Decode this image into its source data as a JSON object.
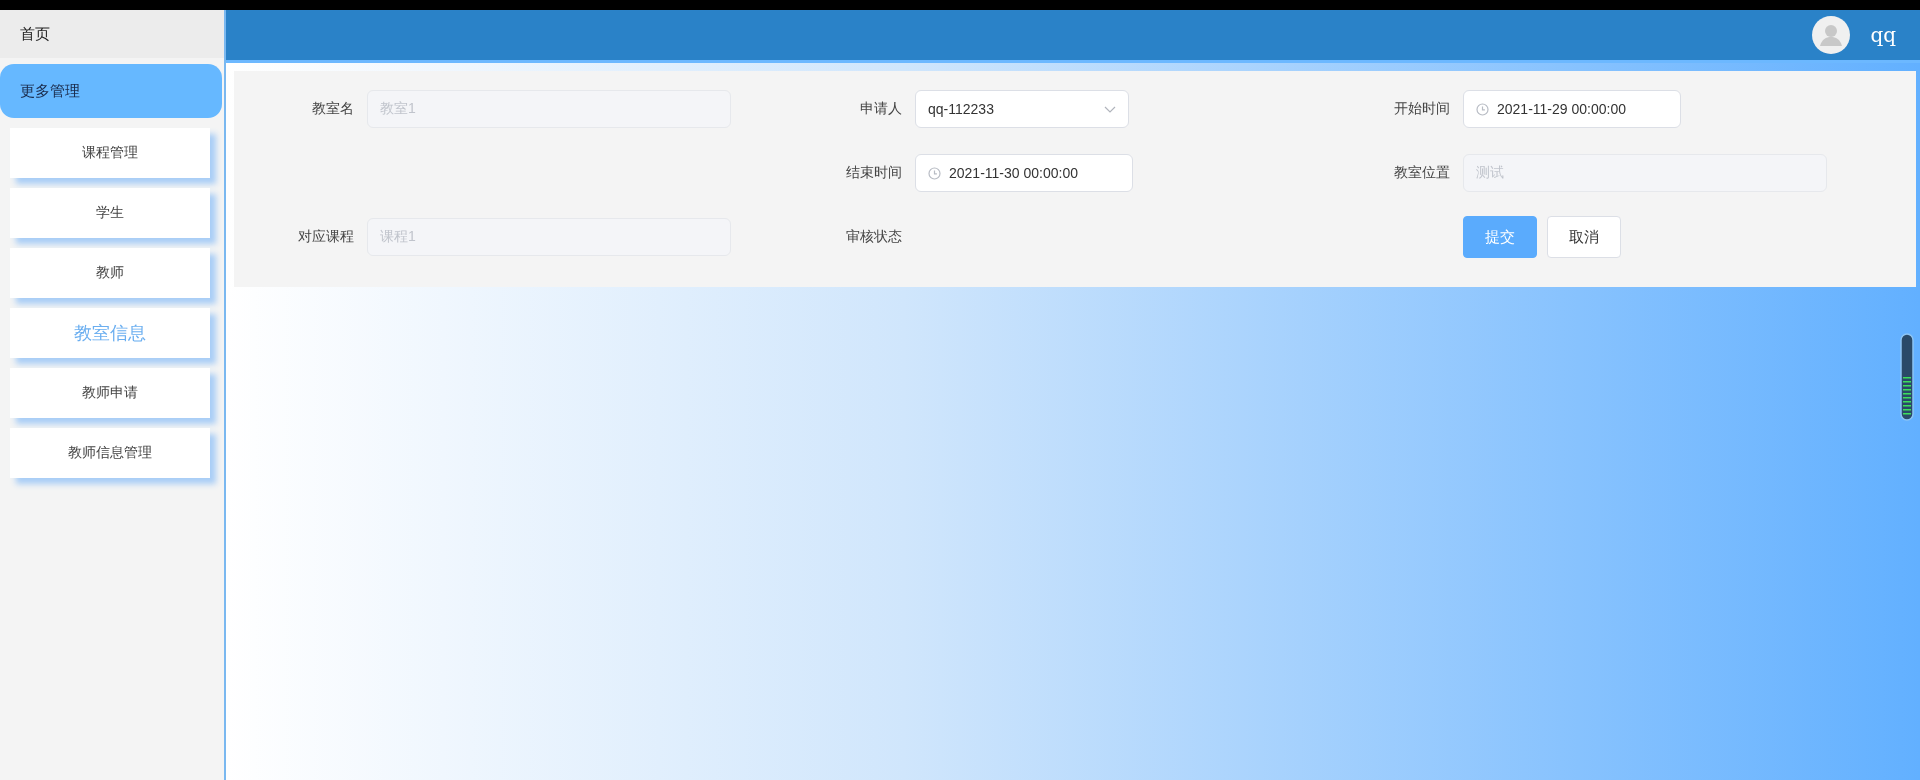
{
  "sidebar": {
    "home": "首页",
    "group": {
      "label": "更多管理"
    },
    "items": [
      {
        "label": "课程管理",
        "selected": false
      },
      {
        "label": "学生",
        "selected": false
      },
      {
        "label": "教师",
        "selected": false
      },
      {
        "label": "教室信息",
        "selected": true
      },
      {
        "label": "教师申请",
        "selected": false
      },
      {
        "label": "教师信息管理",
        "selected": false
      }
    ]
  },
  "header": {
    "user": "qq"
  },
  "form": {
    "rows": [
      [
        {
          "kind": "text",
          "label": "教室名",
          "value": "教室1",
          "disabled": true
        },
        {
          "kind": "select",
          "label": "申请人",
          "value": "qq-112233",
          "disabled": false
        },
        {
          "kind": "date",
          "label": "开始时间",
          "value": "2021-11-29 00:00:00",
          "disabled": false
        }
      ],
      [
        "",
        {
          "kind": "date",
          "label": "结束时间",
          "value": "2021-11-30 00:00:00",
          "disabled": false
        },
        {
          "kind": "text",
          "label": "教室位置",
          "value": "测试",
          "disabled": true
        }
      ],
      [
        {
          "kind": "text",
          "label": "对应课程",
          "value": "课程1",
          "disabled": true
        },
        {
          "kind": "label",
          "label": "审核状态"
        },
        {
          "kind": "buttons",
          "buttons": [
            {
              "label": "提交",
              "kind": "primary"
            },
            {
              "label": "取消",
              "kind": "default"
            }
          ]
        }
      ]
    ]
  }
}
